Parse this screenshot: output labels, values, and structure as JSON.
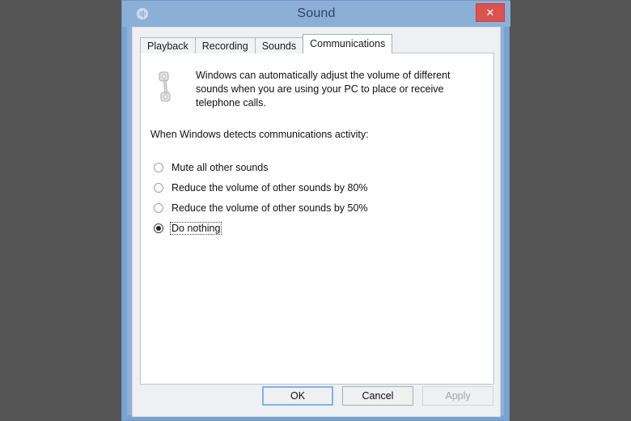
{
  "desktop": {
    "background_color": "#555555"
  },
  "window": {
    "title": "Sound",
    "icon": "speaker-icon",
    "close_label": "✕",
    "frame_color": "#8cafd7",
    "close_button_color": "#d9534f"
  },
  "tabs": [
    {
      "label": "Playback",
      "active": false
    },
    {
      "label": "Recording",
      "active": false
    },
    {
      "label": "Sounds",
      "active": false
    },
    {
      "label": "Communications",
      "active": true
    }
  ],
  "panel": {
    "icon": "telephone-handset-icon",
    "description": "Windows can automatically adjust the volume of different sounds when you are using your PC to place or receive telephone calls.",
    "group_prompt": "When Windows detects communications activity:",
    "options": [
      {
        "label": "Mute all other sounds",
        "selected": false,
        "focused": false
      },
      {
        "label": "Reduce the volume of other sounds by 80%",
        "selected": false,
        "focused": false
      },
      {
        "label": "Reduce the volume of other sounds by 50%",
        "selected": false,
        "focused": false
      },
      {
        "label": "Do nothing",
        "selected": true,
        "focused": true
      }
    ]
  },
  "buttons": {
    "ok": "OK",
    "cancel": "Cancel",
    "apply": "Apply"
  }
}
